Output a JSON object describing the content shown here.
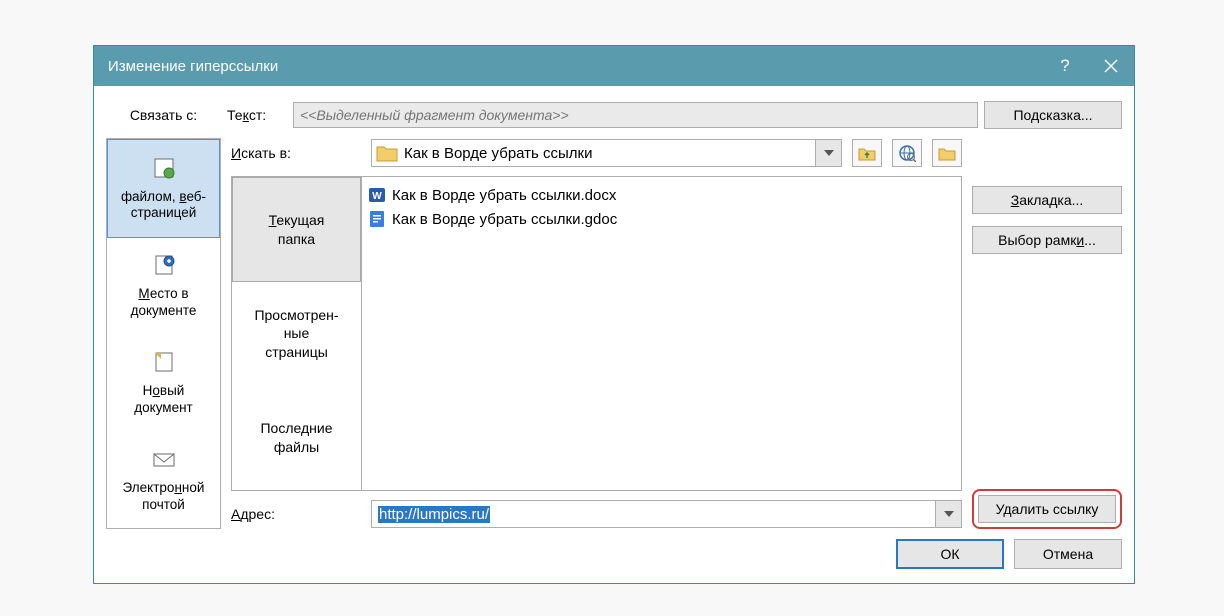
{
  "title": "Изменение гиперссылки",
  "row1": {
    "link_label": "Связать с:",
    "text_label": "Текст:",
    "placeholder": "<<Выделенный фрагмент документа>>",
    "tooltip_btn": "Подсказка..."
  },
  "link_panel": [
    {
      "label_line1": "файлом, веб-",
      "label_line2": "страницей",
      "icon": "🌐",
      "active": true,
      "key_u": "в"
    },
    {
      "label_line1": "Место в",
      "label_line2": "документе",
      "icon": "📄",
      "active": false,
      "key_u": "М"
    },
    {
      "label_line1": "Новый",
      "label_line2": "документ",
      "icon": "📝",
      "active": false,
      "key_u": "о"
    },
    {
      "label_line1": "Электронной",
      "label_line2": "почтой",
      "icon": "✉️",
      "active": false,
      "key_u": "н"
    }
  ],
  "search": {
    "label": "Искать в:",
    "folder": "Как в Ворде убрать ссылки"
  },
  "tabs": [
    {
      "label_line1": "Текущая",
      "label_line2": "папка",
      "active": true
    },
    {
      "label_line1": "Просмотрен-",
      "label_line2": "ные",
      "label_line3": "страницы",
      "active": false
    },
    {
      "label_line1": "Последние",
      "label_line2": "файлы",
      "active": false
    }
  ],
  "files": [
    {
      "name": "Как в Ворде убрать ссылки.docx",
      "type": "docx"
    },
    {
      "name": "Как в Ворде убрать ссылки.gdoc",
      "type": "gdoc"
    }
  ],
  "addr": {
    "label": "Адрес:",
    "value": "http://lumpics.ru/"
  },
  "right": {
    "bookmark": "Закладка...",
    "frame": "Выбор рамки...",
    "remove": "Удалить ссылку"
  },
  "foot": {
    "ok": "ОК",
    "cancel": "Отмена"
  }
}
